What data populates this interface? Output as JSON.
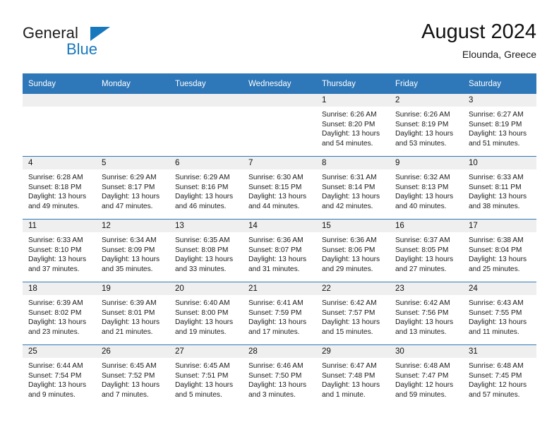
{
  "brand": {
    "name_part1": "General",
    "name_part2": "Blue",
    "logo_icon": "triangle-logo-icon",
    "accent_color": "#1878be"
  },
  "header": {
    "title": "August 2024",
    "subtitle": "Elounda, Greece"
  },
  "calendar": {
    "header_color": "#2e77b8",
    "weekdays": [
      "Sunday",
      "Monday",
      "Tuesday",
      "Wednesday",
      "Thursday",
      "Friday",
      "Saturday"
    ],
    "weeks": [
      [
        {
          "day": "",
          "empty": true
        },
        {
          "day": "",
          "empty": true
        },
        {
          "day": "",
          "empty": true
        },
        {
          "day": "",
          "empty": true
        },
        {
          "day": "1",
          "sunrise": "Sunrise: 6:26 AM",
          "sunset": "Sunset: 8:20 PM",
          "daylight_line1": "Daylight: 13 hours",
          "daylight_line2": "and 54 minutes."
        },
        {
          "day": "2",
          "sunrise": "Sunrise: 6:26 AM",
          "sunset": "Sunset: 8:19 PM",
          "daylight_line1": "Daylight: 13 hours",
          "daylight_line2": "and 53 minutes."
        },
        {
          "day": "3",
          "sunrise": "Sunrise: 6:27 AM",
          "sunset": "Sunset: 8:19 PM",
          "daylight_line1": "Daylight: 13 hours",
          "daylight_line2": "and 51 minutes."
        }
      ],
      [
        {
          "day": "4",
          "sunrise": "Sunrise: 6:28 AM",
          "sunset": "Sunset: 8:18 PM",
          "daylight_line1": "Daylight: 13 hours",
          "daylight_line2": "and 49 minutes."
        },
        {
          "day": "5",
          "sunrise": "Sunrise: 6:29 AM",
          "sunset": "Sunset: 8:17 PM",
          "daylight_line1": "Daylight: 13 hours",
          "daylight_line2": "and 47 minutes."
        },
        {
          "day": "6",
          "sunrise": "Sunrise: 6:29 AM",
          "sunset": "Sunset: 8:16 PM",
          "daylight_line1": "Daylight: 13 hours",
          "daylight_line2": "and 46 minutes."
        },
        {
          "day": "7",
          "sunrise": "Sunrise: 6:30 AM",
          "sunset": "Sunset: 8:15 PM",
          "daylight_line1": "Daylight: 13 hours",
          "daylight_line2": "and 44 minutes."
        },
        {
          "day": "8",
          "sunrise": "Sunrise: 6:31 AM",
          "sunset": "Sunset: 8:14 PM",
          "daylight_line1": "Daylight: 13 hours",
          "daylight_line2": "and 42 minutes."
        },
        {
          "day": "9",
          "sunrise": "Sunrise: 6:32 AM",
          "sunset": "Sunset: 8:13 PM",
          "daylight_line1": "Daylight: 13 hours",
          "daylight_line2": "and 40 minutes."
        },
        {
          "day": "10",
          "sunrise": "Sunrise: 6:33 AM",
          "sunset": "Sunset: 8:11 PM",
          "daylight_line1": "Daylight: 13 hours",
          "daylight_line2": "and 38 minutes."
        }
      ],
      [
        {
          "day": "11",
          "sunrise": "Sunrise: 6:33 AM",
          "sunset": "Sunset: 8:10 PM",
          "daylight_line1": "Daylight: 13 hours",
          "daylight_line2": "and 37 minutes."
        },
        {
          "day": "12",
          "sunrise": "Sunrise: 6:34 AM",
          "sunset": "Sunset: 8:09 PM",
          "daylight_line1": "Daylight: 13 hours",
          "daylight_line2": "and 35 minutes."
        },
        {
          "day": "13",
          "sunrise": "Sunrise: 6:35 AM",
          "sunset": "Sunset: 8:08 PM",
          "daylight_line1": "Daylight: 13 hours",
          "daylight_line2": "and 33 minutes."
        },
        {
          "day": "14",
          "sunrise": "Sunrise: 6:36 AM",
          "sunset": "Sunset: 8:07 PM",
          "daylight_line1": "Daylight: 13 hours",
          "daylight_line2": "and 31 minutes."
        },
        {
          "day": "15",
          "sunrise": "Sunrise: 6:36 AM",
          "sunset": "Sunset: 8:06 PM",
          "daylight_line1": "Daylight: 13 hours",
          "daylight_line2": "and 29 minutes."
        },
        {
          "day": "16",
          "sunrise": "Sunrise: 6:37 AM",
          "sunset": "Sunset: 8:05 PM",
          "daylight_line1": "Daylight: 13 hours",
          "daylight_line2": "and 27 minutes."
        },
        {
          "day": "17",
          "sunrise": "Sunrise: 6:38 AM",
          "sunset": "Sunset: 8:04 PM",
          "daylight_line1": "Daylight: 13 hours",
          "daylight_line2": "and 25 minutes."
        }
      ],
      [
        {
          "day": "18",
          "sunrise": "Sunrise: 6:39 AM",
          "sunset": "Sunset: 8:02 PM",
          "daylight_line1": "Daylight: 13 hours",
          "daylight_line2": "and 23 minutes."
        },
        {
          "day": "19",
          "sunrise": "Sunrise: 6:39 AM",
          "sunset": "Sunset: 8:01 PM",
          "daylight_line1": "Daylight: 13 hours",
          "daylight_line2": "and 21 minutes."
        },
        {
          "day": "20",
          "sunrise": "Sunrise: 6:40 AM",
          "sunset": "Sunset: 8:00 PM",
          "daylight_line1": "Daylight: 13 hours",
          "daylight_line2": "and 19 minutes."
        },
        {
          "day": "21",
          "sunrise": "Sunrise: 6:41 AM",
          "sunset": "Sunset: 7:59 PM",
          "daylight_line1": "Daylight: 13 hours",
          "daylight_line2": "and 17 minutes."
        },
        {
          "day": "22",
          "sunrise": "Sunrise: 6:42 AM",
          "sunset": "Sunset: 7:57 PM",
          "daylight_line1": "Daylight: 13 hours",
          "daylight_line2": "and 15 minutes."
        },
        {
          "day": "23",
          "sunrise": "Sunrise: 6:42 AM",
          "sunset": "Sunset: 7:56 PM",
          "daylight_line1": "Daylight: 13 hours",
          "daylight_line2": "and 13 minutes."
        },
        {
          "day": "24",
          "sunrise": "Sunrise: 6:43 AM",
          "sunset": "Sunset: 7:55 PM",
          "daylight_line1": "Daylight: 13 hours",
          "daylight_line2": "and 11 minutes."
        }
      ],
      [
        {
          "day": "25",
          "sunrise": "Sunrise: 6:44 AM",
          "sunset": "Sunset: 7:54 PM",
          "daylight_line1": "Daylight: 13 hours",
          "daylight_line2": "and 9 minutes."
        },
        {
          "day": "26",
          "sunrise": "Sunrise: 6:45 AM",
          "sunset": "Sunset: 7:52 PM",
          "daylight_line1": "Daylight: 13 hours",
          "daylight_line2": "and 7 minutes."
        },
        {
          "day": "27",
          "sunrise": "Sunrise: 6:45 AM",
          "sunset": "Sunset: 7:51 PM",
          "daylight_line1": "Daylight: 13 hours",
          "daylight_line2": "and 5 minutes."
        },
        {
          "day": "28",
          "sunrise": "Sunrise: 6:46 AM",
          "sunset": "Sunset: 7:50 PM",
          "daylight_line1": "Daylight: 13 hours",
          "daylight_line2": "and 3 minutes."
        },
        {
          "day": "29",
          "sunrise": "Sunrise: 6:47 AM",
          "sunset": "Sunset: 7:48 PM",
          "daylight_line1": "Daylight: 13 hours",
          "daylight_line2": "and 1 minute."
        },
        {
          "day": "30",
          "sunrise": "Sunrise: 6:48 AM",
          "sunset": "Sunset: 7:47 PM",
          "daylight_line1": "Daylight: 12 hours",
          "daylight_line2": "and 59 minutes."
        },
        {
          "day": "31",
          "sunrise": "Sunrise: 6:48 AM",
          "sunset": "Sunset: 7:45 PM",
          "daylight_line1": "Daylight: 12 hours",
          "daylight_line2": "and 57 minutes."
        }
      ]
    ]
  }
}
